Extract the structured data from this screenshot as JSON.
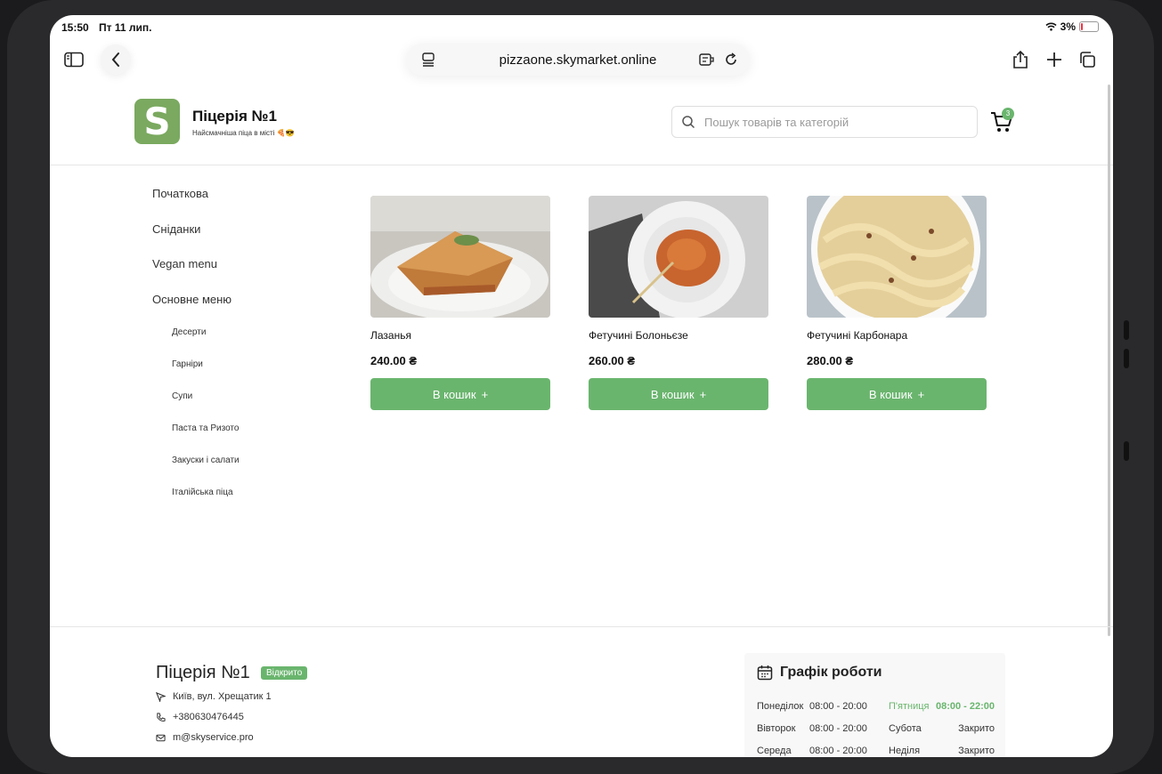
{
  "status_bar": {
    "time": "15:50",
    "date": "Пт 11 лип.",
    "battery": "3%"
  },
  "browser": {
    "url": "pizzaone.skymarket.online"
  },
  "site": {
    "title": "Піцерія №1",
    "subtitle": "Найсмачніша піца в місті 🍕😎",
    "logo_letter": "S",
    "search_placeholder": "Пошук товарів та категорій",
    "cart_count": "3"
  },
  "nav": {
    "top": [
      "Початкова",
      "Сніданки",
      "Vegan menu",
      "Основне меню"
    ],
    "sub": [
      "Десерти",
      "Гарніри",
      "Супи",
      "Паста та Ризото",
      "Закуски і салати",
      "Італійська піца"
    ]
  },
  "products": [
    {
      "name": "Лазанья",
      "price": "240.00 ₴",
      "button": "В кошик"
    },
    {
      "name": "Фетучині Болоньєзе",
      "price": "260.00 ₴",
      "button": "В кошик"
    },
    {
      "name": "Фетучині Карбонара",
      "price": "280.00 ₴",
      "button": "В кошик"
    }
  ],
  "footer": {
    "title": "Піцерія №1",
    "status": "Відкрито",
    "address": "Київ, вул. Хрещатик 1",
    "phone": "+380630476445",
    "email": "m@skyservice.pro"
  },
  "schedule": {
    "title": "Графік роботи",
    "days": [
      {
        "day": "Понеділок",
        "hours": "08:00 - 20:00"
      },
      {
        "day": "Вівторок",
        "hours": "08:00 - 20:00"
      },
      {
        "day": "Середа",
        "hours": "08:00 - 20:00"
      },
      {
        "day": "П'ятниця",
        "hours": "08:00 - 22:00"
      },
      {
        "day": "Субота",
        "hours": "Закрито"
      },
      {
        "day": "Неділя",
        "hours": "Закрито"
      }
    ]
  },
  "colors": {
    "accent": "#6ab56e",
    "logo": "#7aa95f"
  }
}
